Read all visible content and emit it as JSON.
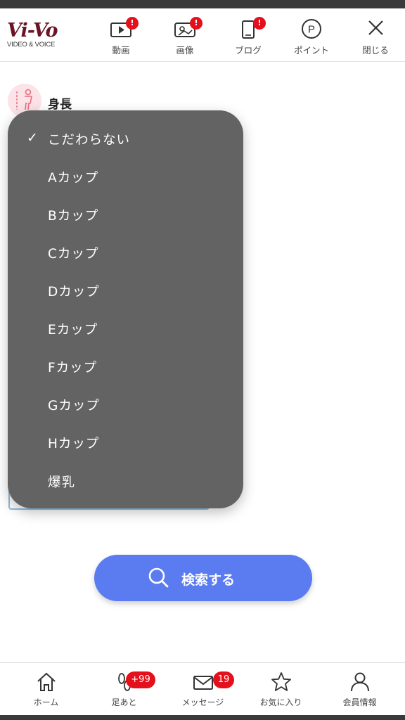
{
  "header": {
    "logo_main": "Vi-Vo",
    "logo_sub": "VIDEO & VOICE",
    "nav": [
      {
        "label": "動画",
        "badge": "!"
      },
      {
        "label": "画像",
        "badge": "!"
      },
      {
        "label": "ブログ",
        "badge": "!"
      },
      {
        "label": "ポイント",
        "icon_glyph": "P"
      },
      {
        "label": "閉じる"
      }
    ]
  },
  "form": {
    "height_label": "身長"
  },
  "dropdown": {
    "selected": "こだわらない",
    "check_mark": "✓",
    "options": [
      "こだわらない",
      "Aカップ",
      "Bカップ",
      "Cカップ",
      "Dカップ",
      "Eカップ",
      "Fカップ",
      "Gカップ",
      "Hカップ",
      "爆乳"
    ]
  },
  "search_button": {
    "label": "検索する"
  },
  "tabbar": {
    "tabs": [
      {
        "label": "ホーム"
      },
      {
        "label": "足あと",
        "badge": "+99"
      },
      {
        "label": "メッセージ",
        "badge": "19"
      },
      {
        "label": "お気に入り"
      },
      {
        "label": "会員情報"
      }
    ]
  },
  "colors": {
    "brand": "#6a1426",
    "badge": "#e4101b",
    "accent": "#5b7bf0",
    "dropdown_bg": "#636363"
  }
}
